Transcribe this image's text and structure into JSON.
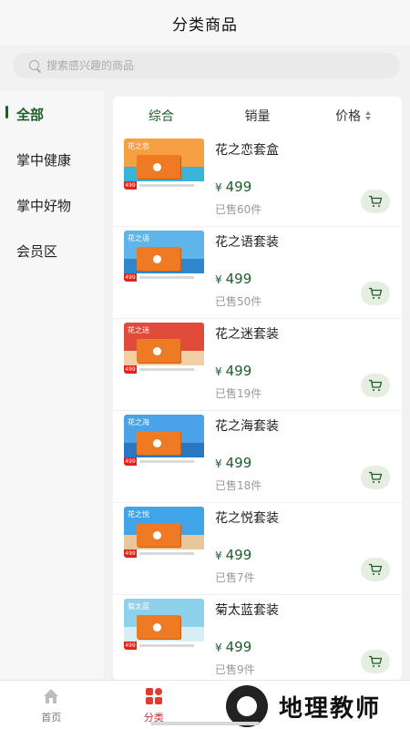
{
  "header": {
    "title": "分类商品"
  },
  "search": {
    "placeholder": "搜索感兴趣的商品"
  },
  "sidebar": {
    "items": [
      {
        "label": "全部",
        "active": true
      },
      {
        "label": "掌中健康",
        "active": false
      },
      {
        "label": "掌中好物",
        "active": false
      },
      {
        "label": "会员区",
        "active": false
      }
    ]
  },
  "sort": {
    "comprehensive": "综合",
    "sales": "销量",
    "price": "价格"
  },
  "currency": "¥",
  "products": [
    {
      "name": "花之恋套盒",
      "price": "499",
      "sold": "已售60件",
      "thumb_label": "花之恋",
      "sky": "#f6a043",
      "sea": "#39b4d8"
    },
    {
      "name": "花之语套装",
      "price": "499",
      "sold": "已售50件",
      "thumb_label": "花之语",
      "sky": "#5db5ea",
      "sea": "#2f86cc"
    },
    {
      "name": "花之迷套装",
      "price": "499",
      "sold": "已售19件",
      "thumb_label": "花之迷",
      "sky": "#e24b3a",
      "sea": "#f1d0a8"
    },
    {
      "name": "花之海套装",
      "price": "499",
      "sold": "已售18件",
      "thumb_label": "花之海",
      "sky": "#4aa3e6",
      "sea": "#2a78c3"
    },
    {
      "name": "花之悦套装",
      "price": "499",
      "sold": "已售7件",
      "thumb_label": "花之悦",
      "sky": "#3fa4e8",
      "sea": "#e8c79c"
    },
    {
      "name": "菊太蓝套装",
      "price": "499",
      "sold": "已售9件",
      "thumb_label": "菊太蓝",
      "sky": "#8ed1ec",
      "sea": "#d7eef6"
    }
  ],
  "tabbar": {
    "home": "首页",
    "category": "分类"
  },
  "watermark": {
    "text": "地理教师"
  },
  "colors": {
    "accent": "#1f5c2b",
    "tab_active": "#c8322e",
    "cart_bg": "#e5eee0"
  }
}
